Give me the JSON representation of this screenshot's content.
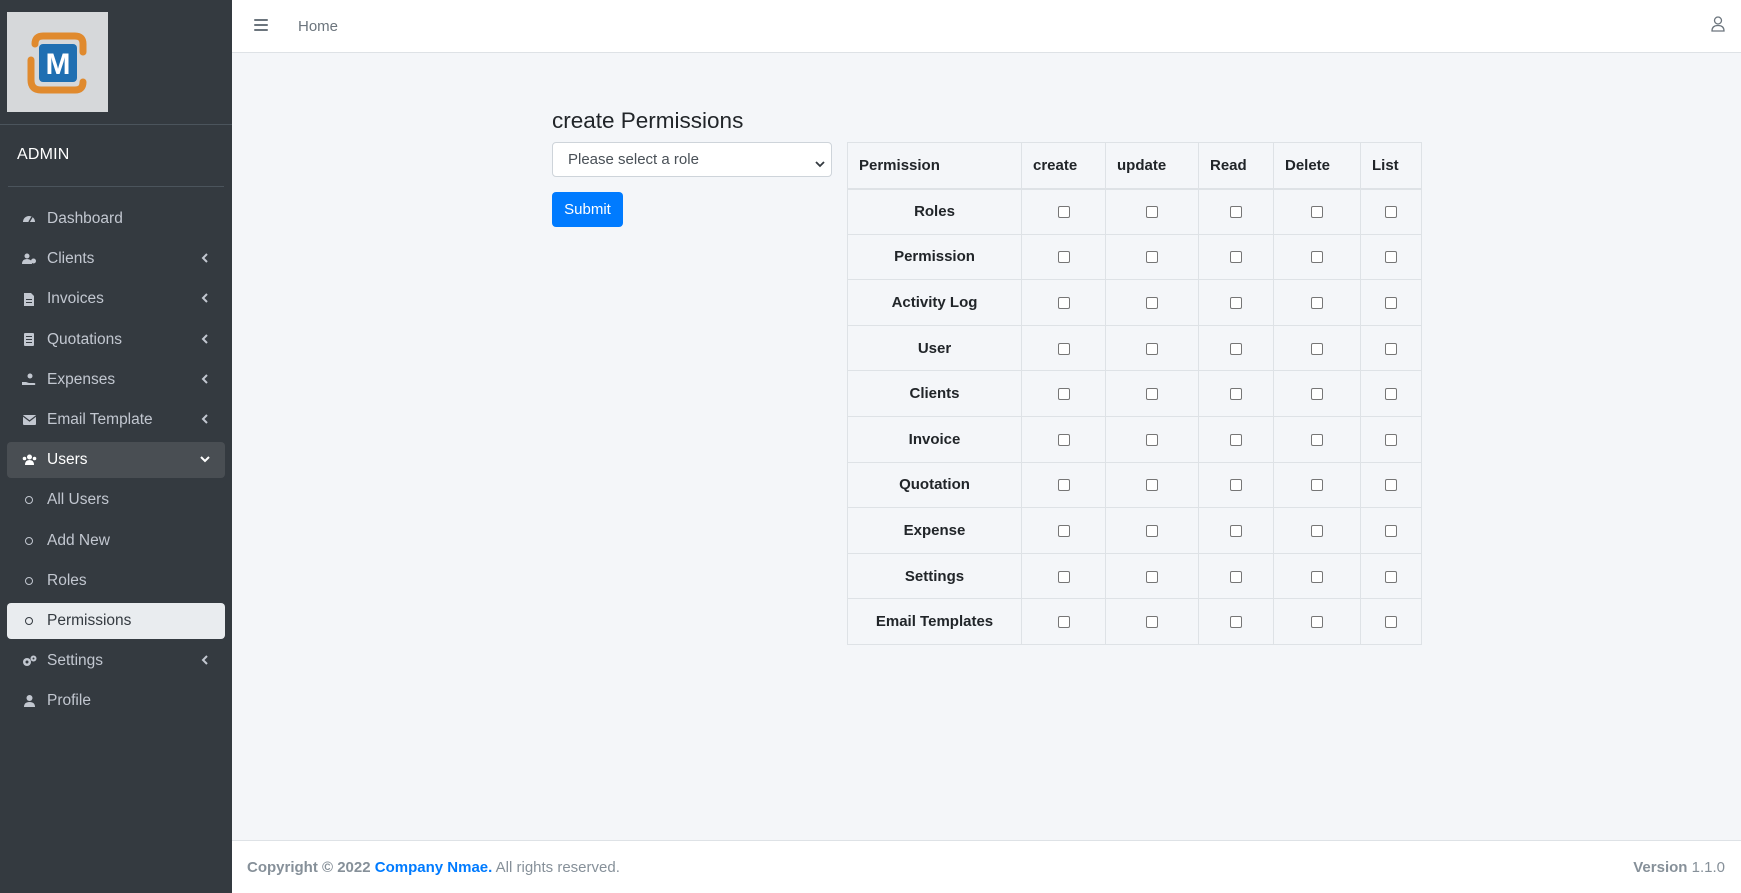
{
  "brand": {
    "logo_text": "M",
    "colors": {
      "logo_blue": "#1f6fb2",
      "logo_orange": "#e08a2e"
    }
  },
  "sidebar": {
    "user_label": "ADMIN",
    "items": [
      {
        "label": "Dashboard",
        "icon": "tachometer-icon",
        "chevron": false
      },
      {
        "label": "Clients",
        "icon": "users-cog-icon",
        "chevron": true
      },
      {
        "label": "Invoices",
        "icon": "file-invoice-icon",
        "chevron": true
      },
      {
        "label": "Quotations",
        "icon": "file-alt-icon",
        "chevron": true
      },
      {
        "label": "Expenses",
        "icon": "hand-holding-dollar-icon",
        "chevron": true
      },
      {
        "label": "Email Template",
        "icon": "envelope-icon",
        "chevron": true
      },
      {
        "label": "Users",
        "icon": "users-icon",
        "chevron": "down",
        "state": "open"
      },
      {
        "label": "All Users",
        "icon": "circle-icon",
        "sub": true
      },
      {
        "label": "Add New",
        "icon": "circle-icon",
        "sub": true
      },
      {
        "label": "Roles",
        "icon": "circle-icon",
        "sub": true
      },
      {
        "label": "Permissions",
        "icon": "circle-icon",
        "sub": true,
        "state": "active"
      },
      {
        "label": "Settings",
        "icon": "cogs-icon",
        "chevron": true
      },
      {
        "label": "Profile",
        "icon": "user-icon",
        "chevron": false
      }
    ]
  },
  "topbar": {
    "home_label": "Home"
  },
  "main": {
    "title": "create Permissions",
    "role_select": {
      "selected": "Please select a role"
    },
    "submit_label": "Submit",
    "table": {
      "headers": [
        "Permission",
        "create",
        "update",
        "Read",
        "Delete",
        "List"
      ],
      "rows": [
        "Roles",
        "Permission",
        "Activity Log",
        "User",
        "Clients",
        "Invoice",
        "Quotation",
        "Expense",
        "Settings",
        "Email Templates"
      ]
    }
  },
  "footer": {
    "copyright_prefix": "Copyright © 2022",
    "company": "Company Nmae.",
    "rights": "All rights reserved.",
    "version_label": "Version",
    "version_number": "1.1.0"
  }
}
